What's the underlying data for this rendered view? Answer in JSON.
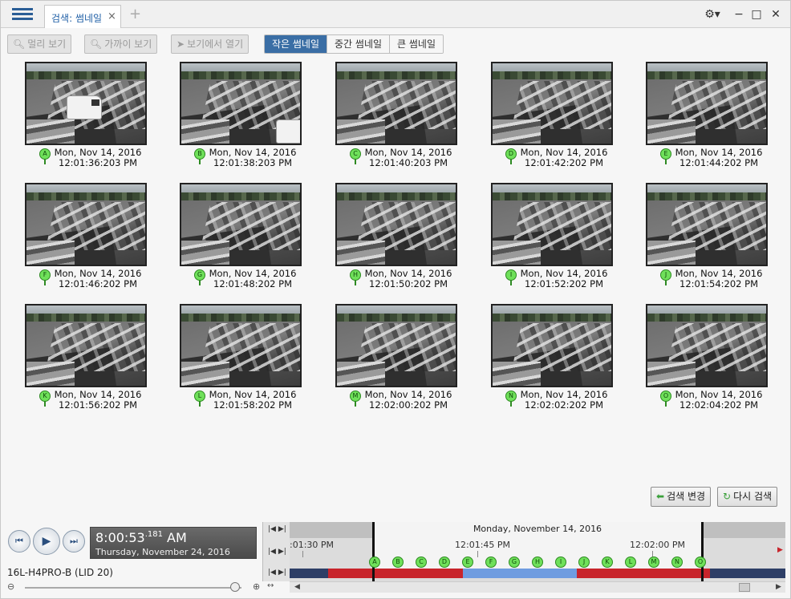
{
  "tabbar": {
    "tab_label": "검색: 썸네일",
    "close_glyph": "×",
    "add_glyph": "+"
  },
  "window": {
    "settings_glyph": "⚙▾",
    "minimize_glyph": "−",
    "maximize_glyph": "□",
    "close_glyph": "✕"
  },
  "toolbar": {
    "zoom_out_label": "멀리 보기",
    "zoom_in_label": "가까이 보기",
    "open_in_view_label": "보기에서 열기",
    "size_options": [
      "작은 썸네일",
      "중간 썸네일",
      "큰 썸네일"
    ],
    "active_size": "작은 썸네일"
  },
  "thumbnails": [
    {
      "marker": "A",
      "date": "Mon, Nov 14, 2016",
      "time": "12:01:36:203 PM"
    },
    {
      "marker": "B",
      "date": "Mon, Nov 14, 2016",
      "time": "12:01:38:203 PM"
    },
    {
      "marker": "C",
      "date": "Mon, Nov 14, 2016",
      "time": "12:01:40:203 PM"
    },
    {
      "marker": "D",
      "date": "Mon, Nov 14, 2016",
      "time": "12:01:42:202 PM"
    },
    {
      "marker": "E",
      "date": "Mon, Nov 14, 2016",
      "time": "12:01:44:202 PM"
    },
    {
      "marker": "F",
      "date": "Mon, Nov 14, 2016",
      "time": "12:01:46:202 PM"
    },
    {
      "marker": "G",
      "date": "Mon, Nov 14, 2016",
      "time": "12:01:48:202 PM"
    },
    {
      "marker": "H",
      "date": "Mon, Nov 14, 2016",
      "time": "12:01:50:202 PM"
    },
    {
      "marker": "I",
      "date": "Mon, Nov 14, 2016",
      "time": "12:01:52:202 PM"
    },
    {
      "marker": "J",
      "date": "Mon, Nov 14, 2016",
      "time": "12:01:54:202 PM"
    },
    {
      "marker": "K",
      "date": "Mon, Nov 14, 2016",
      "time": "12:01:56:202 PM"
    },
    {
      "marker": "L",
      "date": "Mon, Nov 14, 2016",
      "time": "12:01:58:202 PM"
    },
    {
      "marker": "M",
      "date": "Mon, Nov 14, 2016",
      "time": "12:02:00:202 PM"
    },
    {
      "marker": "N",
      "date": "Mon, Nov 14, 2016",
      "time": "12:02:02:202 PM"
    },
    {
      "marker": "O",
      "date": "Mon, Nov 14, 2016",
      "time": "12:02:04:202 PM"
    }
  ],
  "actions": {
    "change_search_label": "검색 변경",
    "search_again_label": "다시 검색"
  },
  "playback": {
    "clock_time": "8:00:53",
    "clock_ms": ".181",
    "clock_ampm": "AM",
    "clock_date": "Thursday, November 24, 2016",
    "camera_label": "16L-H4PRO-B (LID 20)"
  },
  "timeline": {
    "date_label": "Monday, November 14, 2016",
    "ticks": [
      ":01:30 PM",
      "12:01:45 PM",
      "12:02:00 PM"
    ],
    "markers": [
      "A",
      "B",
      "C",
      "D",
      "E",
      "F",
      "G",
      "H",
      "I",
      "J",
      "K",
      "L",
      "M",
      "N",
      "O"
    ],
    "colors": {
      "recording": "#c8242b",
      "motion": "#6f9ce0",
      "dark": "#2d3e66"
    }
  }
}
